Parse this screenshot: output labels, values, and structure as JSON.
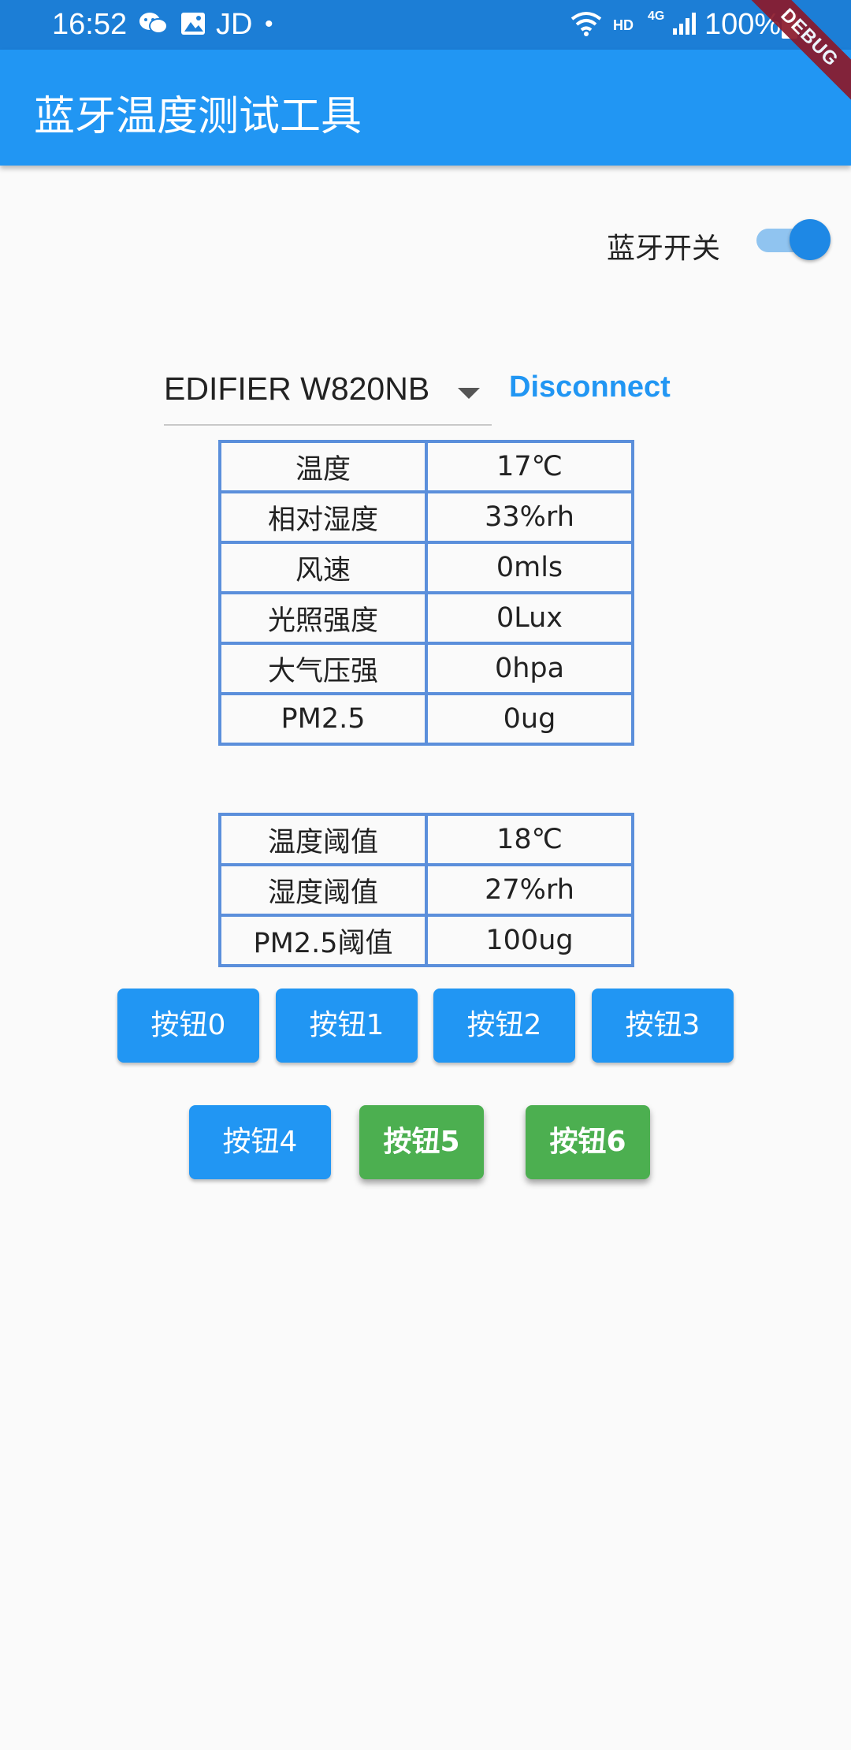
{
  "status_bar": {
    "time": "16:52",
    "carrier_text": "JD",
    "dot": "•",
    "hd_label": "HD",
    "network_label": "4G",
    "battery_percent": "100%",
    "icons": [
      "wechat-icon",
      "image-icon",
      "wifi-icon",
      "signal-icon",
      "battery-icon"
    ]
  },
  "app_bar": {
    "title": "蓝牙温度测试工具",
    "debug_banner": "DEBUG"
  },
  "bluetooth": {
    "label": "蓝牙开关",
    "enabled": true
  },
  "device": {
    "selected": "EDIFIER W820NB",
    "disconnect_label": "Disconnect"
  },
  "readings": [
    {
      "label": "温度",
      "value": "17℃"
    },
    {
      "label": "相对湿度",
      "value": "33%rh"
    },
    {
      "label": "风速",
      "value": "0mls"
    },
    {
      "label": "光照强度",
      "value": "0Lux"
    },
    {
      "label": "大气压强",
      "value": "0hpa"
    },
    {
      "label": "PM2.5",
      "value": "0ug"
    }
  ],
  "thresholds": [
    {
      "label": "温度阈值",
      "value": "18℃"
    },
    {
      "label": "湿度阈值",
      "value": "27%rh"
    },
    {
      "label": "PM2.5阈值",
      "value": "100ug"
    }
  ],
  "buttons": [
    "按钮0",
    "按钮1",
    "按钮2",
    "按钮3",
    "按钮4",
    "按钮5",
    "按钮6"
  ],
  "colors": {
    "status_bar": "#1c7ed6",
    "app_bar": "#2196f3",
    "primary_button": "#2196f3",
    "active_button": "#4caf50",
    "table_border": "#5b8fdb",
    "debug_ribbon": "#8b1a2b"
  }
}
